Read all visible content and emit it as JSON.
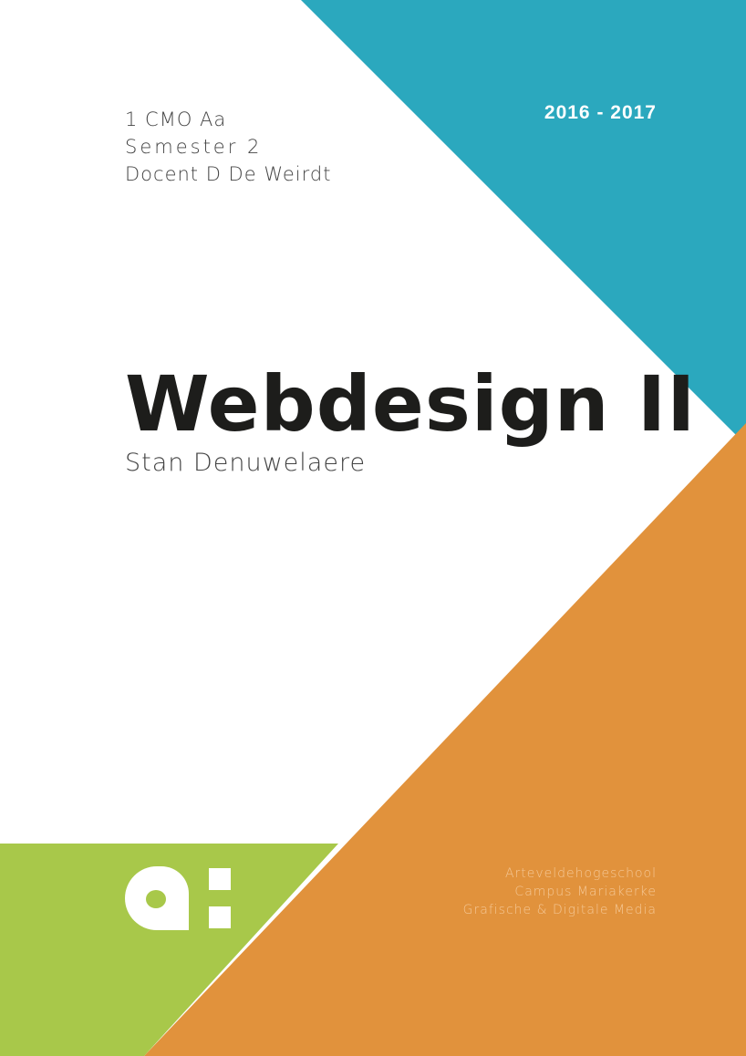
{
  "cover": {
    "class_line": "1 CMO Aa",
    "semester_line": "Semester 2",
    "docent_line": "Docent D De Weirdt",
    "year": "2016 - 2017",
    "title": "Webdesign II",
    "author": "Stan Denuwelaere",
    "school": {
      "name": "Arteveldehogeschool",
      "campus": "Campus Mariakerke",
      "department": "Grafische & Digitale Media"
    }
  },
  "colors": {
    "teal": "#2ba8be",
    "orange": "#e1923c",
    "green": "#a8c84a",
    "text": "#1d1d1b"
  },
  "icons": {
    "logo": "arteveldehogeschool-a-colon-logo"
  }
}
